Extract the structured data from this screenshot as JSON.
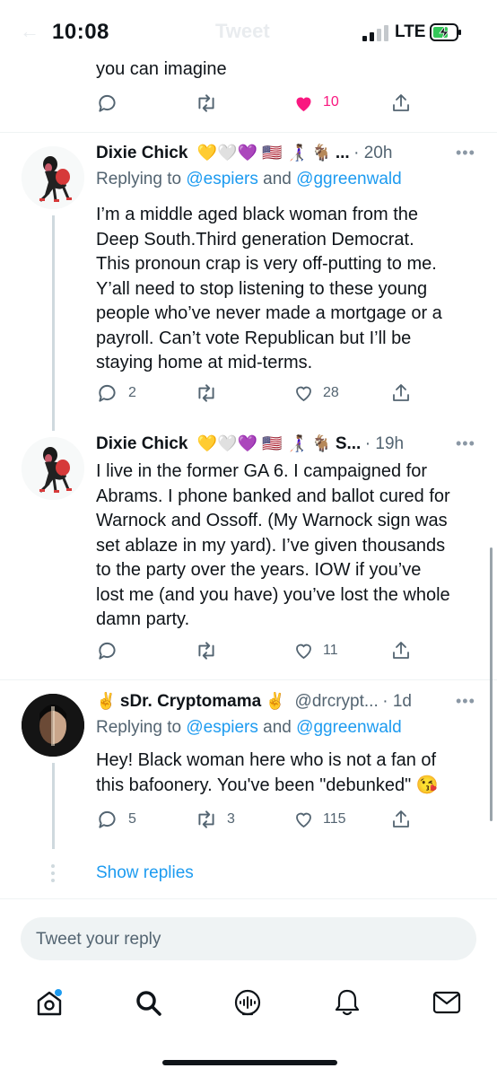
{
  "status_bar": {
    "time": "10:08",
    "network": "LTE",
    "ghost_title": "Tweet"
  },
  "top_tweet": {
    "text_tail": "you can imagine",
    "like_count": "10"
  },
  "tweets": [
    {
      "name": "Dixie Chick",
      "emojis": "💛🤍💜 🇺🇸 👩🏾‍🦯 🐐",
      "ellipsis": "...",
      "time": "20h",
      "replying_label": "Replying to",
      "mention_1": "@espiers",
      "and_label": "and",
      "mention_2": "@ggreenwald",
      "lines": [
        "I’m a middle aged black woman from the",
        "Deep South.Third generation Democrat.",
        "This pronoun crap is very off-putting to me.",
        "Y’all need to stop listening to these young",
        "people who’ve never made a mortgage or a",
        "payroll. Can’t vote Republican but I’ll be",
        "staying home at mid-terms."
      ],
      "reply_count": "2",
      "retweet_count": "",
      "like_count": "28"
    },
    {
      "name": "Dixie Chick",
      "emojis": "💛🤍💜 🇺🇸 👩🏾‍🦯 🐐",
      "ellipsis": "S...",
      "time": "19h",
      "lines": [
        "I live in the former GA 6. I campaigned for",
        "Abrams. I phone banked and ballot cured for",
        "Warnock and Ossoff. (My Warnock sign was",
        "set ablaze in my yard). I’ve given thousands",
        "to the party over the years. IOW if you’ve",
        "lost me (and you have) you’ve lost the whole",
        "damn party."
      ],
      "reply_count": "",
      "retweet_count": "",
      "like_count": "11"
    },
    {
      "name_prefix": "✌️",
      "name": "sDr. Cryptomama",
      "name_suffix": "✌️",
      "handle": "@drcrypt...",
      "time": "1d",
      "replying_label": "Replying to",
      "mention_1": "@espiers",
      "and_label": "and",
      "mention_2": "@ggreenwald",
      "lines": [
        "Hey! Black woman here who is not a fan of",
        "this bafoonery. You've been \"debunked\" 😘"
      ],
      "reply_count": "5",
      "retweet_count": "3",
      "like_count": "115"
    }
  ],
  "show_replies": "Show replies",
  "compose_placeholder": "Tweet your reply",
  "tab_bar": [
    "home-icon",
    "search-icon",
    "spaces-icon",
    "notifications-icon",
    "messages-icon"
  ],
  "colors": {
    "accent": "#1d9bf0",
    "like": "#f91880",
    "muted": "#536471"
  }
}
